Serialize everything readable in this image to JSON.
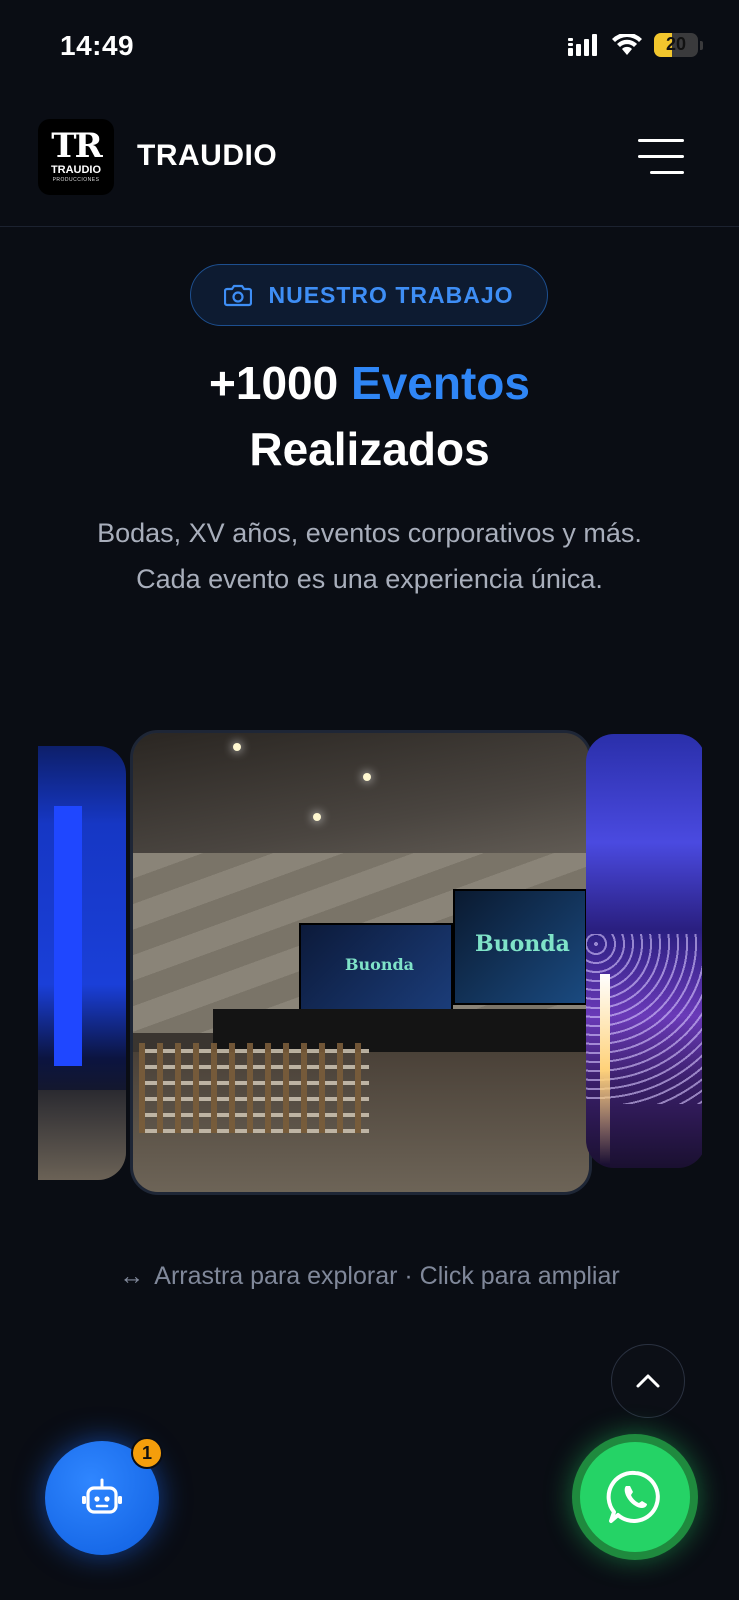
{
  "status_bar": {
    "time": "14:49",
    "battery_level": "20"
  },
  "header": {
    "logo": {
      "mark": "TR",
      "name": "TRAUDIO",
      "sub": "PRODUCCIONES"
    },
    "brand": "TRAUDIO",
    "menu_icon": "hamburger-menu-icon"
  },
  "hero": {
    "badge": {
      "icon": "camera-icon",
      "label": "NUESTRO TRABAJO"
    },
    "title_prefix": "+1000",
    "title_accent": "Eventos",
    "title_line2": "Realizados",
    "description_line1": "Bodas, XV años, eventos corporativos y más.",
    "description_line2": "Cada evento es una experiencia única."
  },
  "gallery": {
    "screen_text": "Buonda",
    "hint_icon": "↔",
    "hint": "Arrastra para explorar · Click para ampliar"
  },
  "floating": {
    "scroll_top_icon": "chevron-up-icon",
    "chatbot_icon": "robot-icon",
    "chatbot_badge": "1",
    "whatsapp_icon": "whatsapp-icon"
  },
  "colors": {
    "background": "#0a0d14",
    "accent_blue": "#2f86f6",
    "whatsapp_green": "#25d366",
    "badge_orange": "#f59e0b"
  }
}
